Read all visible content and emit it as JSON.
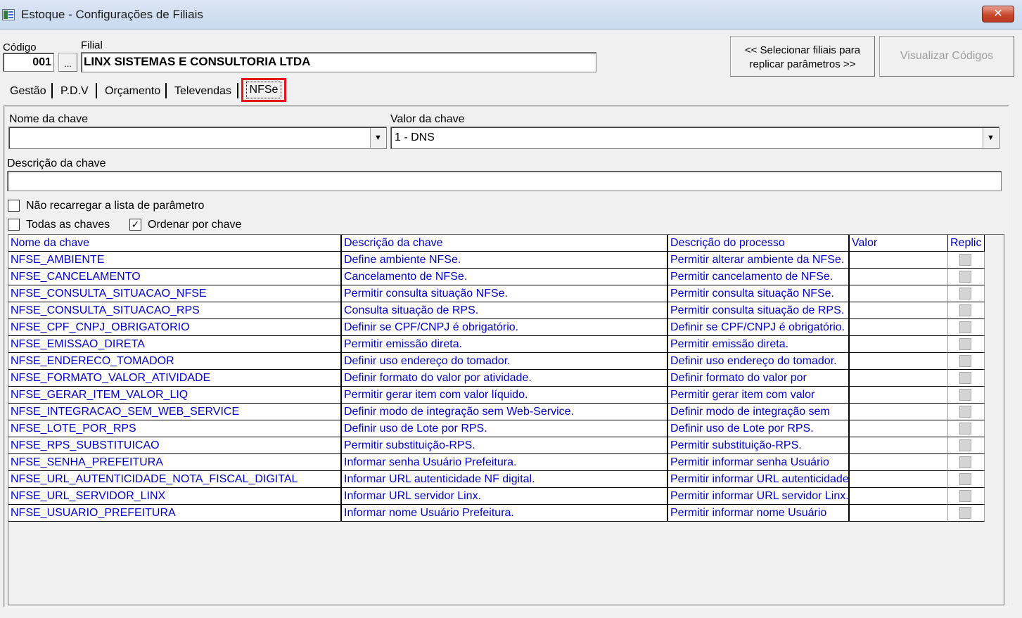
{
  "window": {
    "title": "Estoque - Configurações de Filiais",
    "close_glyph": "✕"
  },
  "header": {
    "codigo_label": "Código",
    "codigo_value": "001",
    "browse_label": "...",
    "filial_label": "Filial",
    "filial_value": "LINX SISTEMAS E CONSULTORIA LTDA",
    "replicate_button_line1": "<< Selecionar filiais para",
    "replicate_button_line2": "replicar parâmetros >>",
    "view_codes_button": "Visualizar Códigos"
  },
  "tabs": [
    {
      "label": "Gestão"
    },
    {
      "label": "P.D.V"
    },
    {
      "label": "Orçamento"
    },
    {
      "label": "Televendas"
    },
    {
      "label": "NFSe",
      "active": true
    }
  ],
  "form": {
    "key_name_label": "Nome da chave",
    "key_name_value": "",
    "key_value_label": "Valor da chave",
    "key_value_value": "1 - DNS",
    "key_desc_label": "Descrição da chave",
    "key_desc_value": "",
    "no_reload_label": "Não recarregar a lista de parâmetro",
    "no_reload_checked": false,
    "all_keys_label": "Todas as chaves",
    "all_keys_checked": false,
    "order_by_key_label": "Ordenar por chave",
    "order_by_key_checked": true,
    "check_glyph": "✓",
    "dropdown_glyph": "▼"
  },
  "grid": {
    "columns": [
      "Nome da chave",
      "Descrição  da chave",
      "Descrição do processo",
      "Valor",
      "Replic"
    ],
    "rows": [
      [
        "NFSE_AMBIENTE",
        "Define ambiente NFSe.",
        "Permitir alterar ambiente da NFSe.",
        ""
      ],
      [
        "NFSE_CANCELAMENTO",
        "Cancelamento de NFSe.",
        "Permitir cancelamento de NFSe.",
        ""
      ],
      [
        "NFSE_CONSULTA_SITUACAO_NFSE",
        "Permitir consulta situação NFSe.",
        "Permitir consulta situação NFSe.",
        ""
      ],
      [
        "NFSE_CONSULTA_SITUACAO_RPS",
        "Consulta situação de RPS.",
        "Permitir consulta situação de RPS.",
        ""
      ],
      [
        "NFSE_CPF_CNPJ_OBRIGATORIO",
        "Definir se CPF/CNPJ é obrigatório.",
        "Definir se CPF/CNPJ é obrigatório.",
        ""
      ],
      [
        "NFSE_EMISSAO_DIRETA",
        "Permitir emissão direta.",
        "Permitir emissão direta.",
        ""
      ],
      [
        "NFSE_ENDERECO_TOMADOR",
        "Definir uso endereço do tomador.",
        "Definir uso endereço do tomador.",
        ""
      ],
      [
        "NFSE_FORMATO_VALOR_ATIVIDADE",
        "Definir formato do valor por atividade.",
        "Definir formato do valor por",
        ""
      ],
      [
        "NFSE_GERAR_ITEM_VALOR_LIQ",
        "Permitir gerar item com valor líquido.",
        "Permitir gerar item com valor",
        ""
      ],
      [
        "NFSE_INTEGRACAO_SEM_WEB_SERVICE",
        "Definir modo de integração sem Web-Service.",
        "Definir modo de integração sem",
        ""
      ],
      [
        "NFSE_LOTE_POR_RPS",
        "Definir uso de Lote por RPS.",
        "Definir uso de Lote por RPS.",
        ""
      ],
      [
        "NFSE_RPS_SUBSTITUICAO",
        "Permitir substituição-RPS.",
        "Permitir substituição-RPS.",
        ""
      ],
      [
        "NFSE_SENHA_PREFEITURA",
        "Informar senha Usuário Prefeitura.",
        "Permitir informar senha Usuário",
        ""
      ],
      [
        "NFSE_URL_AUTENTICIDADE_NOTA_FISCAL_DIGITAL",
        "Informar URL autenticidade NF digital.",
        "Permitir informar URL autenticidade",
        ""
      ],
      [
        "NFSE_URL_SERVIDOR_LINX",
        "Informar URL servidor Linx.",
        "Permitir informar URL servidor Linx.",
        ""
      ],
      [
        "NFSE_USUARIO_PREFEITURA",
        "Informar nome Usuário Prefeitura.",
        "Permitir informar nome Usuário",
        ""
      ]
    ]
  },
  "colors": {
    "grid_text": "#0000c8",
    "highlight": "#e3161b",
    "titlebar": "#c9d9ee"
  }
}
